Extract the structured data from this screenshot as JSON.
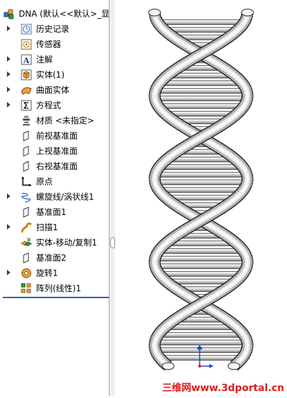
{
  "tree": {
    "root_label": "DNA  (默认<<默认>_显",
    "items": [
      {
        "label": "历史记录",
        "icon": "history-icon",
        "expandable": true
      },
      {
        "label": "传感器",
        "icon": "sensor-icon",
        "expandable": false
      },
      {
        "label": "注解",
        "icon": "annotation-icon",
        "expandable": true
      },
      {
        "label": "实体(1)",
        "icon": "solid-bodies-icon",
        "expandable": true
      },
      {
        "label": "曲面实体",
        "icon": "surface-bodies-icon",
        "expandable": true
      },
      {
        "label": "方程式",
        "icon": "equations-icon",
        "expandable": true
      },
      {
        "label": "材质 <未指定>",
        "icon": "material-icon",
        "expandable": false
      },
      {
        "label": "前视基准面",
        "icon": "plane-icon",
        "expandable": false
      },
      {
        "label": "上视基准面",
        "icon": "plane-icon",
        "expandable": false
      },
      {
        "label": "右视基准面",
        "icon": "plane-icon",
        "expandable": false
      },
      {
        "label": "原点",
        "icon": "origin-icon",
        "expandable": false
      },
      {
        "label": "螺旋线/涡状线1",
        "icon": "helix-icon",
        "expandable": true
      },
      {
        "label": "基准面1",
        "icon": "plane-icon",
        "expandable": false
      },
      {
        "label": "扫描1",
        "icon": "sweep-icon",
        "expandable": true
      },
      {
        "label": "实体-移动/复制1",
        "icon": "move-copy-body-icon",
        "expandable": false
      },
      {
        "label": "基准面2",
        "icon": "plane-icon",
        "expandable": false
      },
      {
        "label": "旋转1",
        "icon": "revolve-icon",
        "expandable": true
      },
      {
        "label": "阵列(线性)1",
        "icon": "linear-pattern-icon",
        "expandable": false
      }
    ]
  },
  "watermark": "三维网www.3dportal.cn",
  "colors": {
    "accent": "#2a5fb5",
    "watermark": "#d81e1e",
    "icon_orange": "#e8a33a",
    "icon_blue": "#3b6fc1",
    "icon_green": "#3a9a3a"
  }
}
